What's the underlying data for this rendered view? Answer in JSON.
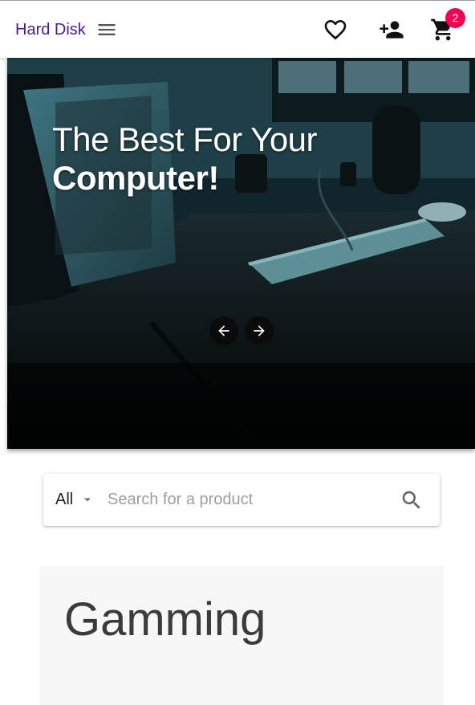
{
  "appbar": {
    "brand": "Hard Disk",
    "cart_count": "2",
    "brand_color": "#4a1d8f",
    "badge_color": "#f50057",
    "icons": [
      "menu-icon",
      "heart-outline-icon",
      "person-add-icon",
      "shopping-cart-icon"
    ]
  },
  "hero": {
    "title_line1": "The Best For Your",
    "title_line2": "Computer!",
    "controls": [
      "arrow-left-icon",
      "arrow-right-icon"
    ]
  },
  "search": {
    "category": "All",
    "placeholder": "Search for a product",
    "icons": [
      "dropdown-caret-icon",
      "search-icon"
    ]
  },
  "section": {
    "title": "Gamming"
  }
}
